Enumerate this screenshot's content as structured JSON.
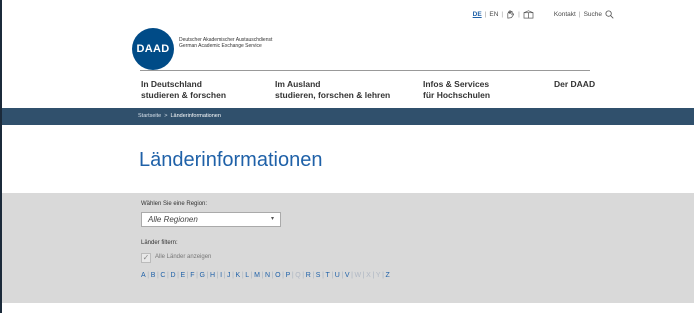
{
  "logo": {
    "abbr": "DAAD",
    "name_de": "Deutscher Akademischer Austauschdienst",
    "name_en": "German Academic Exchange Service"
  },
  "topbar": {
    "languages": [
      {
        "code": "DE",
        "active": true
      },
      {
        "code": "EN",
        "active": false
      }
    ],
    "kontakt": "Kontakt",
    "suche": "Suche"
  },
  "nav": [
    {
      "line1": "In Deutschland",
      "line2": "studieren & forschen"
    },
    {
      "line1": "Im Ausland",
      "line2": "studieren, forschen & lehren"
    },
    {
      "line1": "Infos & Services",
      "line2": "für Hochschulen"
    },
    {
      "line1": "Der DAAD",
      "line2": ""
    }
  ],
  "breadcrumb": {
    "home": "Startseite",
    "separator": ">",
    "current": "Länderinformationen"
  },
  "page_title": "Länderinformationen",
  "filter": {
    "region_label": "Wählen Sie eine Region:",
    "region_selected": "Alle Regionen",
    "filter_label": "Länder filtern:",
    "show_all_label": "Alle Länder anzeigen",
    "letters": [
      {
        "l": "A",
        "enabled": true
      },
      {
        "l": "B",
        "enabled": true
      },
      {
        "l": "C",
        "enabled": true
      },
      {
        "l": "D",
        "enabled": true
      },
      {
        "l": "E",
        "enabled": true
      },
      {
        "l": "F",
        "enabled": true
      },
      {
        "l": "G",
        "enabled": true
      },
      {
        "l": "H",
        "enabled": true
      },
      {
        "l": "I",
        "enabled": true
      },
      {
        "l": "J",
        "enabled": true
      },
      {
        "l": "K",
        "enabled": true
      },
      {
        "l": "L",
        "enabled": true
      },
      {
        "l": "M",
        "enabled": true
      },
      {
        "l": "N",
        "enabled": true
      },
      {
        "l": "O",
        "enabled": true
      },
      {
        "l": "P",
        "enabled": true
      },
      {
        "l": "Q",
        "enabled": false
      },
      {
        "l": "R",
        "enabled": true
      },
      {
        "l": "S",
        "enabled": true
      },
      {
        "l": "T",
        "enabled": true
      },
      {
        "l": "U",
        "enabled": true
      },
      {
        "l": "V",
        "enabled": true
      },
      {
        "l": "W",
        "enabled": false
      },
      {
        "l": "X",
        "enabled": false
      },
      {
        "l": "Y",
        "enabled": false
      },
      {
        "l": "Z",
        "enabled": true
      }
    ]
  },
  "colors": {
    "brand_blue": "#004b87",
    "link_blue": "#1f61a8",
    "breadcrumb_bg": "#30506c",
    "filter_bg": "#d9d9d9"
  }
}
